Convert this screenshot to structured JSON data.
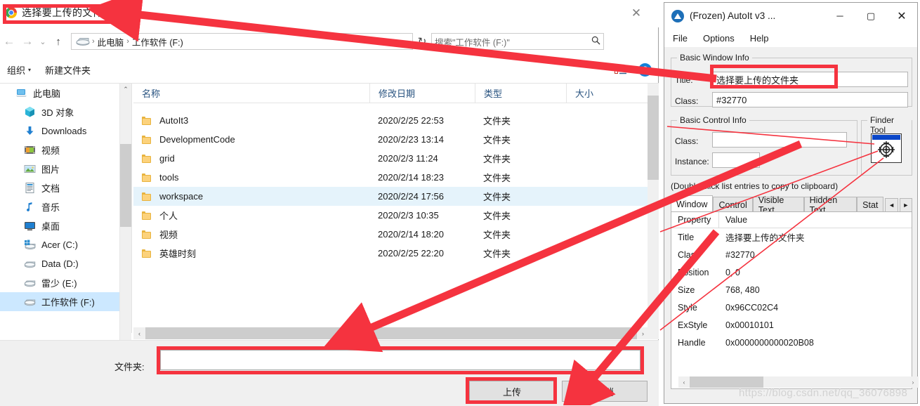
{
  "file_dialog": {
    "title": "选择要上传的文件夹",
    "close_label": "✕",
    "nav": {
      "back": "←",
      "forward": "→",
      "recent": "⌄",
      "up": "↑",
      "refresh": "↻",
      "addr_caret": "⌄",
      "breadcrumbs": [
        "此电脑",
        "工作软件 (F:)"
      ],
      "crumb_sep": "›",
      "search_placeholder": "搜索\"工作软件 (F:)\"",
      "search_icon": "search-icon"
    },
    "commandbar": {
      "organize": "组织",
      "organize_caret": "▾",
      "new_folder": "新建文件夹",
      "view_caret": "▾",
      "help": "?"
    },
    "nav_pane": {
      "items": [
        {
          "label": "此电脑",
          "icon": "this-pc-icon",
          "level": 1,
          "selected": false
        },
        {
          "label": "3D 对象",
          "icon": "3d-objects-icon",
          "level": 2,
          "selected": false
        },
        {
          "label": "Downloads",
          "icon": "downloads-icon",
          "level": 2,
          "selected": false
        },
        {
          "label": "视频",
          "icon": "videos-icon",
          "level": 2,
          "selected": false
        },
        {
          "label": "图片",
          "icon": "pictures-icon",
          "level": 2,
          "selected": false
        },
        {
          "label": "文档",
          "icon": "documents-icon",
          "level": 2,
          "selected": false
        },
        {
          "label": "音乐",
          "icon": "music-icon",
          "level": 2,
          "selected": false
        },
        {
          "label": "桌面",
          "icon": "desktop-icon",
          "level": 2,
          "selected": false
        },
        {
          "label": "Acer (C:)",
          "icon": "windows-drive-icon",
          "level": 2,
          "selected": false
        },
        {
          "label": "Data (D:)",
          "icon": "drive-icon",
          "level": 2,
          "selected": false
        },
        {
          "label": "雷少 (E:)",
          "icon": "drive-icon",
          "level": 2,
          "selected": false
        },
        {
          "label": "工作软件 (F:)",
          "icon": "drive-icon",
          "level": 2,
          "selected": true
        }
      ],
      "scroll_up": "⌃",
      "scroll_down": "⌄"
    },
    "list": {
      "columns": [
        "名称",
        "修改日期",
        "类型",
        "大小"
      ],
      "sort_caret": "⌃",
      "rows": [
        {
          "name": "AutoIt3",
          "date": "2020/2/25 22:53",
          "type": "文件夹",
          "size": "",
          "selected": false
        },
        {
          "name": "DevelopmentCode",
          "date": "2020/2/23 13:14",
          "type": "文件夹",
          "size": "",
          "selected": false
        },
        {
          "name": "grid",
          "date": "2020/2/3 11:24",
          "type": "文件夹",
          "size": "",
          "selected": false
        },
        {
          "name": "tools",
          "date": "2020/2/14 18:23",
          "type": "文件夹",
          "size": "",
          "selected": false
        },
        {
          "name": "workspace",
          "date": "2020/2/24 17:56",
          "type": "文件夹",
          "size": "",
          "selected": true
        },
        {
          "name": "个人",
          "date": "2020/2/3 10:35",
          "type": "文件夹",
          "size": "",
          "selected": false
        },
        {
          "name": "视频",
          "date": "2020/2/14 18:20",
          "type": "文件夹",
          "size": "",
          "selected": false
        },
        {
          "name": "英雄时刻",
          "date": "2020/2/25 22:20",
          "type": "文件夹",
          "size": "",
          "selected": false
        }
      ],
      "hsb_left": "‹",
      "hsb_right": "›"
    },
    "bottom": {
      "folder_label": "文件夹:",
      "folder_value": "",
      "upload_button": "上传",
      "cancel_button": "取消"
    }
  },
  "autoit": {
    "title": "(Frozen) AutoIt v3 ...",
    "window_buttons": {
      "minimize": "─",
      "maximize": "▢",
      "close": "✕"
    },
    "menu": [
      "File",
      "Options",
      "Help"
    ],
    "basic_window_info": {
      "group_title": "Basic Window Info",
      "title_label": "Title:",
      "title_value": "选择要上传的文件夹",
      "class_label": "Class:",
      "class_value": "#32770"
    },
    "basic_control_info": {
      "group_title": "Basic Control Info",
      "class_label": "Class:",
      "class_value": "",
      "instance_label": "Instance:",
      "instance_value": ""
    },
    "finder_tool": {
      "group_title": "Finder Tool",
      "icon": "finder-target-icon"
    },
    "hint": "(Double-click list entries to copy to clipboard)",
    "tabs": [
      {
        "label": "Window",
        "active": true
      },
      {
        "label": "Control",
        "active": false
      },
      {
        "label": "Visible Text",
        "active": false
      },
      {
        "label": "Hidden Text",
        "active": false
      },
      {
        "label": "Stat",
        "active": false
      }
    ],
    "tab_scroll_left": "◄",
    "tab_scroll_right": "►",
    "property_list": {
      "headers": [
        "Property",
        "Value"
      ],
      "rows": [
        {
          "property": "Title",
          "value": "选择要上传的文件夹"
        },
        {
          "property": "Class",
          "value": "#32770"
        },
        {
          "property": "Position",
          "value": "0, 0"
        },
        {
          "property": "Size",
          "value": "768, 480"
        },
        {
          "property": "Style",
          "value": "0x96CC02C4"
        },
        {
          "property": "ExStyle",
          "value": "0x00010101"
        },
        {
          "property": "Handle",
          "value": "0x0000000000020B08"
        }
      ],
      "hsb_left": "‹",
      "hsb_right": "›"
    }
  },
  "watermark": "https://blog.csdn.net/qq_36076898",
  "annotation_color": "#f5333f"
}
